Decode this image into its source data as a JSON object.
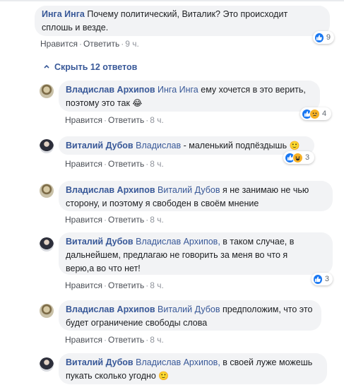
{
  "top_comment": {
    "author": "Инга Инга",
    "text": "Почему политический, Виталик? Это происходит сплошь и везде.",
    "line1": "Почему политический, Виталик? Это происходит",
    "line2": "сплошь и везде.",
    "like": "Нравится",
    "reply": "Ответить",
    "time": "9 ч.",
    "reactions_count": "9"
  },
  "hide_replies": "Скрыть 12 ответов",
  "replies": [
    {
      "author": "Владислав Архипов",
      "mention": "Инга Инга",
      "line1": "ему хочется в это верить,",
      "line2": "поэтому это так",
      "emoji": "😂",
      "like": "Нравится",
      "reply": "Ответить",
      "time": "8 ч.",
      "reactions_count": "4"
    },
    {
      "author": "Виталий Дубов",
      "mention": "Владислав",
      "line1": "- маленький подпёздышь",
      "emoji": "🙂",
      "like": "Нравится",
      "reply": "Ответить",
      "time": "8 ч.",
      "reactions_count": "3"
    },
    {
      "author": "Владислав Архипов",
      "mention": "Виталий Дубов",
      "line1": "я не занимаю не чью",
      "line2": "сторону, и поэтому я свободен в своём мнение",
      "like": "Нравится",
      "reply": "Ответить",
      "time": "8 ч."
    },
    {
      "author": "Виталий Дубов",
      "mention": "Владислав Архипов,",
      "line1": "в таком случае, в",
      "line2": "дальнейшем, предлагаю не говорить за меня во что я",
      "line3": "верю,а во что нет!",
      "like": "Нравится",
      "reply": "Ответить",
      "time": "8 ч.",
      "reactions_count": "3"
    },
    {
      "author": "Владислав Архипов",
      "mention": "Виталий Дубов",
      "line1": "предположим, что это",
      "line2": "будет ограничение свободы слова",
      "like": "Нравится",
      "reply": "Ответить",
      "time": "8 ч."
    },
    {
      "author": "Виталий Дубов",
      "mention": "Владислав Архипов,",
      "line1": "в своей луже можешь",
      "line2": "пукать сколько угодно",
      "emoji": "🙂"
    }
  ],
  "colors": {
    "link": "#385898",
    "bubble": "#f2f3f5",
    "like_blue": "#1877f2",
    "reaction_yellow": "#f7b125",
    "meta": "#606770"
  }
}
